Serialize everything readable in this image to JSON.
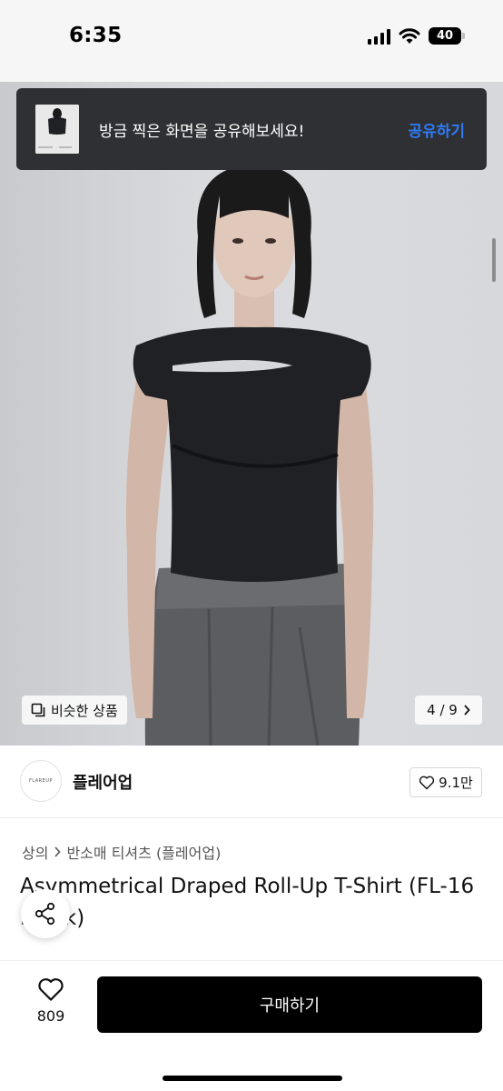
{
  "status_bar": {
    "time": "6:35",
    "battery": "40"
  },
  "toast": {
    "message": "방금 찍은 화면을 공유해보세요!",
    "action": "공유하기"
  },
  "gallery": {
    "similar_label": "비슷한 상품",
    "page_indicator": "4 / 9"
  },
  "shop": {
    "logo_text": "FLAREUP",
    "name": "플레어업",
    "likes": "9.1만"
  },
  "product": {
    "breadcrumb": [
      "상의",
      "반소매 티셔츠 (플레어업)"
    ],
    "title": "Asymmetrical Draped Roll-Up T-Shirt (FL-16 Black)"
  },
  "bottom_bar": {
    "wish_count": "809",
    "buy_label": "구매하기"
  },
  "colors": {
    "accent": "#2d7bf6",
    "toast_bg": "#2f3033",
    "buy_bg": "#000000"
  }
}
